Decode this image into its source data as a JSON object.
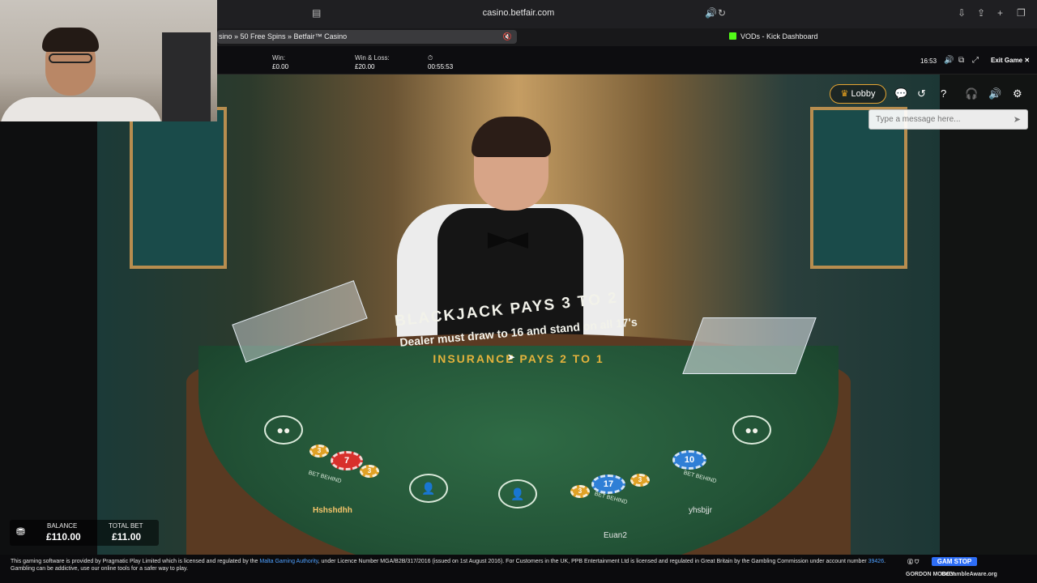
{
  "browser": {
    "url": "casino.betfair.com",
    "tabs": [
      {
        "label": "sino » 50 Free Spins » Betfair™ Casino"
      },
      {
        "label": "VODs - Kick Dashboard"
      }
    ]
  },
  "game_header": {
    "win_label": "Win:",
    "win_value": "£0.00",
    "winloss_label": "Win & Loss:",
    "winloss_value": "£20.00",
    "timer_icon": "stopwatch-icon",
    "session_time": "00:55:53",
    "clock": "16:53",
    "exit_label": "Exit Game"
  },
  "overlay": {
    "lobby_label": "Lobby",
    "chat_placeholder": "Type a message here..."
  },
  "table": {
    "line1": "BLACKJACK PAYS 3 TO 2",
    "line2": "Dealer must draw to 16 and stand on all 17's",
    "line3": "INSURANCE PAYS 2 TO 1",
    "bet_behind": "BET BEHIND",
    "seat_chips": [
      {
        "value": "7",
        "color": "#d8302c"
      },
      {
        "value": "17",
        "color": "#2f7fd6"
      },
      {
        "value": "10",
        "color": "#2f7fd6"
      }
    ],
    "side_chip": "3",
    "players": [
      "Hshshdhh",
      "Euan2",
      "yhsbjjr"
    ]
  },
  "balance": {
    "balance_label": "BALANCE",
    "balance_value": "£110.00",
    "total_bet_label": "TOTAL BET",
    "total_bet_value": "£11.00"
  },
  "footer": {
    "text_a": "This gaming software is provided by Pragmatic Play Limited which is licensed and regulated by the",
    "link_a": "Malta Gaming Authority",
    "text_b": ", under Licence Number MGA/B2B/317/2016 (issued on 1st August 2016). For Customers in the UK, PPB Entertainment Ltd is licensed and regulated in Great Britain by the Gambling Commission under account number",
    "link_b": "39426",
    "text_c": ". Gambling can be addictive, use our online tools for a safer way to play.",
    "gamstop": "GAM STOP",
    "begambleaware": "BeGambleAware.org",
    "gordon_moody": "GORDON MOODY"
  },
  "colors": {
    "accent_lobby": "#e6a532",
    "felt": "#235437",
    "link": "#4ea0ff"
  }
}
